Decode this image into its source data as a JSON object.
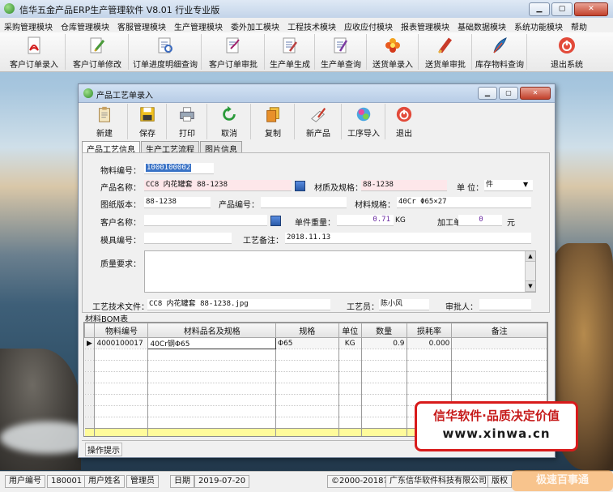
{
  "app": {
    "title": "信华五金产品ERP生产管理软件  V8.01 行业专业版"
  },
  "menu": [
    "采购管理模块",
    "仓库管理模块",
    "客服管理模块",
    "生产管理模块",
    "委外加工模块",
    "工程技术模块",
    "应收应付模块",
    "报表管理模块",
    "基础数据模块",
    "系统功能模块",
    "帮助"
  ],
  "toolbar": [
    {
      "label": "客户订单录入",
      "icon": "pdf-document-icon"
    },
    {
      "label": "客户订单修改",
      "icon": "edit-document-icon"
    },
    {
      "label": "订单进度明细查询",
      "icon": "document-search-icon"
    },
    {
      "label": "客户订单审批",
      "icon": "approve-document-icon"
    },
    {
      "label": "生产单生成",
      "icon": "generate-document-icon"
    },
    {
      "label": "生产单查询",
      "icon": "query-document-icon"
    },
    {
      "label": "送货单录入",
      "icon": "flower-icon"
    },
    {
      "label": "送货单审批",
      "icon": "brush-icon"
    },
    {
      "label": "库存物料查询",
      "icon": "feather-icon"
    },
    {
      "label": "退出系统",
      "icon": "power-icon"
    }
  ],
  "dialog": {
    "title": "产品工艺单录入",
    "tools": [
      {
        "label": "新建",
        "icon": "clipboard-icon"
      },
      {
        "label": "保存",
        "icon": "save-icon"
      },
      {
        "label": "打印",
        "icon": "printer-icon"
      },
      {
        "label": "取消",
        "icon": "cancel-icon"
      },
      {
        "label": "复制",
        "icon": "copy-icon"
      },
      {
        "label": "新产品",
        "icon": "new-product-icon"
      },
      {
        "label": "工序导入",
        "icon": "import-icon"
      },
      {
        "label": "退出",
        "icon": "exit-icon"
      }
    ],
    "tabs": [
      "产品工艺信息",
      "生产工艺流程",
      "图片信息"
    ]
  },
  "form": {
    "material_no_label": "物料编号：",
    "material_no": "1000100002",
    "product_name_label": "产品名称：",
    "product_name": "CC8 内花罐套 88-1238",
    "spec_label": "材质及规格：",
    "spec": "88-1238",
    "unit_label": "单  位：",
    "unit": "件",
    "drawing_label": "图纸版本：",
    "drawing": "88-1238",
    "product_code_label": "产品编号：",
    "product_code": "",
    "material_spec_label": "材料规格：",
    "material_spec": "40Cr  Φ65×27",
    "customer_label": "客户名称：",
    "customer": "",
    "unit_weight_label": "单件重量：",
    "unit_weight": "0.71",
    "weight_unit": "KG",
    "unit_price_label": "加工单价：",
    "unit_price": "0",
    "currency": "元",
    "mold_label": "模具编号：",
    "mold": "",
    "process_note_label": "工艺备注：",
    "process_note": "2018.11.13",
    "quality_label": "质量要求：",
    "quality": "",
    "tech_file_label": "工艺技术文件：",
    "tech_file": "CC8 内花罐套 88-1238.jpg",
    "technician_label": "工艺员：",
    "technician": "陈小风",
    "approver_label": "审批人：",
    "approver": ""
  },
  "bom": {
    "label": "材料BOM表",
    "columns": [
      "物料编号",
      "材料品名及规格",
      "规格",
      "单位",
      "数量",
      "损耗率",
      "备注"
    ],
    "rows": [
      {
        "code": "4000100017",
        "name": "40Cr钢Φ65",
        "spec": "Φ65",
        "unit": "KG",
        "qty": "0.9",
        "loss": "0.000",
        "note": ""
      }
    ],
    "hint_tab": "操作提示"
  },
  "status": {
    "user_no_label": "用户编号",
    "user_no": "180001",
    "user_name_label": "用户姓名",
    "user_name": "管理员",
    "date_label": "日期",
    "date": "2019-07-20",
    "copyright": "©2000-2018?",
    "company": "广东信华软件科技有限公司",
    "version_label": "版权"
  },
  "promo": {
    "line1": "信华软件·品质决定价值",
    "line2": "www.xinwa.cn"
  },
  "watermark": "极速百事通",
  "colors": {
    "highlight": "#3a73c6",
    "required_field": "#fde7ea",
    "bom_footer": "#fffb9a",
    "promo_border": "#d81b1b"
  }
}
